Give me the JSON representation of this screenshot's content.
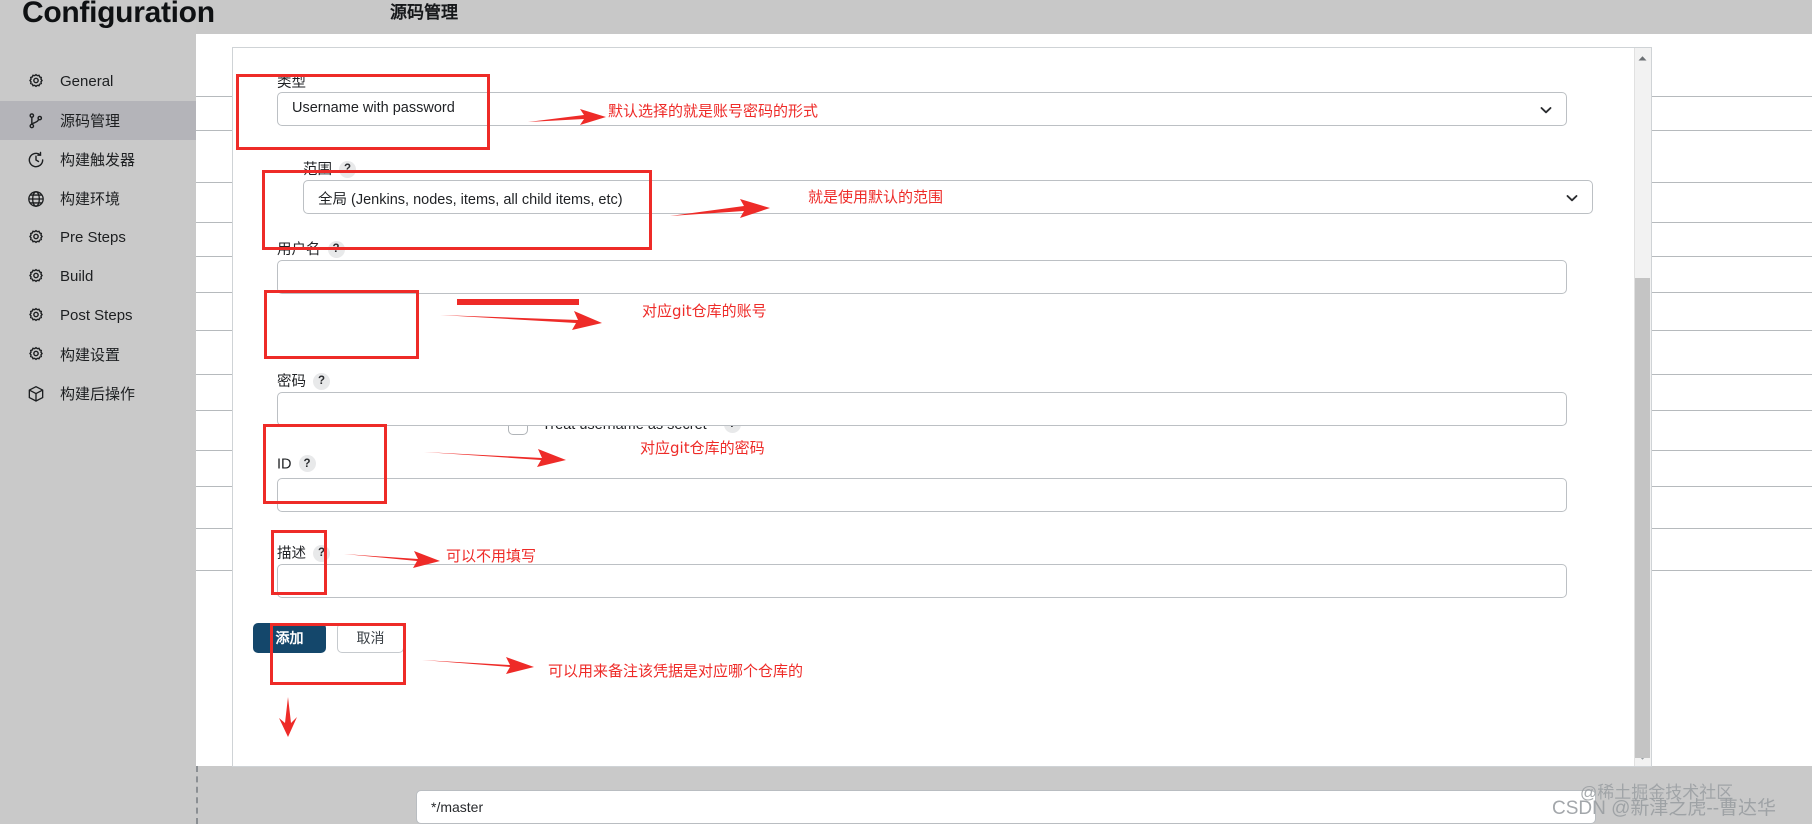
{
  "page": {
    "title": "Configuration",
    "section_header": "源码管理"
  },
  "sidebar": {
    "items": [
      {
        "label": "General",
        "icon": "gear-icon",
        "active": false
      },
      {
        "label": "源码管理",
        "icon": "git-branch-icon",
        "active": true
      },
      {
        "label": "构建触发器",
        "icon": "clock-icon",
        "active": false
      },
      {
        "label": "构建环境",
        "icon": "globe-icon",
        "active": false
      },
      {
        "label": "Pre Steps",
        "icon": "gear-icon",
        "active": false
      },
      {
        "label": "Build",
        "icon": "gear-icon",
        "active": false
      },
      {
        "label": "Post Steps",
        "icon": "gear-icon",
        "active": false
      },
      {
        "label": "构建设置",
        "icon": "gear-icon",
        "active": false
      },
      {
        "label": "构建后操作",
        "icon": "package-icon",
        "active": false
      }
    ]
  },
  "dialog": {
    "fields": {
      "kind": {
        "label": "类型",
        "value": "Username with password",
        "control": "select"
      },
      "scope": {
        "label": "范围",
        "help": "?",
        "value": "全局 (Jenkins, nodes, items, all child items, etc)",
        "control": "select"
      },
      "username": {
        "label": "用户名",
        "help": "?",
        "value": "",
        "placeholder": "",
        "control": "text"
      },
      "treat_as_secret": {
        "label": "Treat username as secret",
        "help": "?",
        "checked": false,
        "control": "checkbox"
      },
      "password": {
        "label": "密码",
        "help": "?",
        "value": "",
        "placeholder": "",
        "control": "password"
      },
      "id": {
        "label": "ID",
        "help": "?",
        "value": "",
        "placeholder": "",
        "control": "text"
      },
      "description": {
        "label": "描述",
        "help": "?",
        "value": "",
        "placeholder": "",
        "control": "text"
      }
    },
    "buttons": {
      "add": "添加",
      "cancel": "取消"
    }
  },
  "annotations": [
    {
      "id": "a1",
      "text": "默认选择的就是账号密码的形式"
    },
    {
      "id": "a2",
      "text": "就是使用默认的范围"
    },
    {
      "id": "a3",
      "text": "对应git仓库的账号"
    },
    {
      "id": "a4",
      "text": "对应git仓库的密码"
    },
    {
      "id": "a5",
      "text": "可以不用填写"
    },
    {
      "id": "a6",
      "text": "可以用来备注该凭据是对应哪个仓库的"
    }
  ],
  "background": {
    "branch_specifier_value": "*/master"
  },
  "watermarks": {
    "line1": "@稀土掘金技术社区",
    "line2": "CSDN @新津之虎--曹达华"
  },
  "colors": {
    "annotation_red": "#ee2b28",
    "primary_button": "#14476b",
    "sidebar_bg": "#c9c9c9",
    "sidebar_active": "#b4b4b9"
  }
}
